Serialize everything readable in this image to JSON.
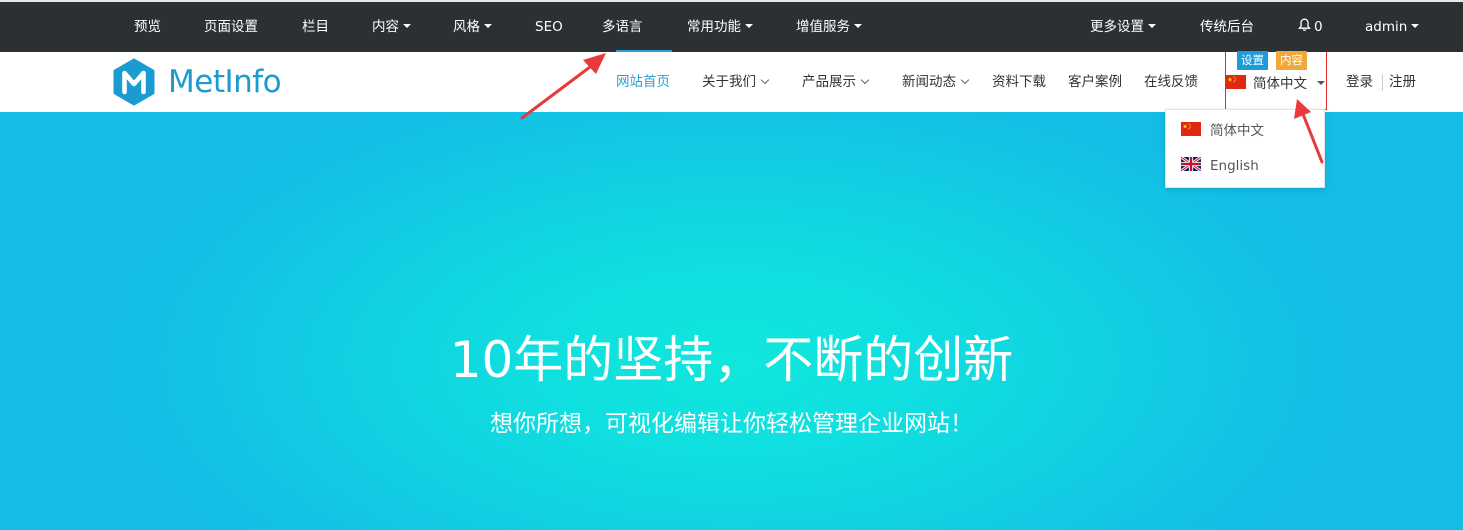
{
  "admin_bar": {
    "items": [
      {
        "label": "预览",
        "dropdown": false
      },
      {
        "label": "页面设置",
        "dropdown": false
      },
      {
        "label": "栏目",
        "dropdown": false
      },
      {
        "label": "内容",
        "dropdown": true
      },
      {
        "label": "风格",
        "dropdown": true
      },
      {
        "label": "SEO",
        "dropdown": false
      },
      {
        "label": "多语言",
        "dropdown": false
      },
      {
        "label": "常用功能",
        "dropdown": true
      },
      {
        "label": "增值服务",
        "dropdown": true
      }
    ],
    "right": {
      "more_settings": "更多设置",
      "classic_backend": "传统后台",
      "notification_count": "0",
      "user": "admin"
    }
  },
  "header": {
    "logo_text": "MetInfo",
    "logo_letter": "M",
    "nav": [
      {
        "label": "网站首页",
        "active": true,
        "dropdown": false
      },
      {
        "label": "关于我们",
        "active": false,
        "dropdown": true
      },
      {
        "label": "产品展示",
        "active": false,
        "dropdown": true
      },
      {
        "label": "新闻动态",
        "active": false,
        "dropdown": true
      },
      {
        "label": "资料下载",
        "active": false,
        "dropdown": false
      },
      {
        "label": "客户案例",
        "active": false,
        "dropdown": false
      },
      {
        "label": "在线反馈",
        "active": false,
        "dropdown": false
      }
    ],
    "badges": {
      "settings": "设置",
      "content": "内容"
    },
    "language_current": "简体中文",
    "login": "登录",
    "register": "注册"
  },
  "language_dropdown": {
    "options": [
      {
        "label": "简体中文",
        "flag": "china-flag-icon"
      },
      {
        "label": "English",
        "flag": "uk-flag-icon"
      }
    ]
  },
  "hero": {
    "title": "10年的坚持，不断的创新",
    "subtitle": "想你所想，可视化编辑让你轻松管理企业网站！"
  },
  "colors": {
    "admin_bar": "#2b3033",
    "accent": "#2aa0d4",
    "badge_settings": "#1e9cd9",
    "badge_content": "#f0a73c",
    "annotation_red": "#e8393b",
    "hero_center": "#0fe7dc",
    "hero_edge": "#13bde6"
  }
}
